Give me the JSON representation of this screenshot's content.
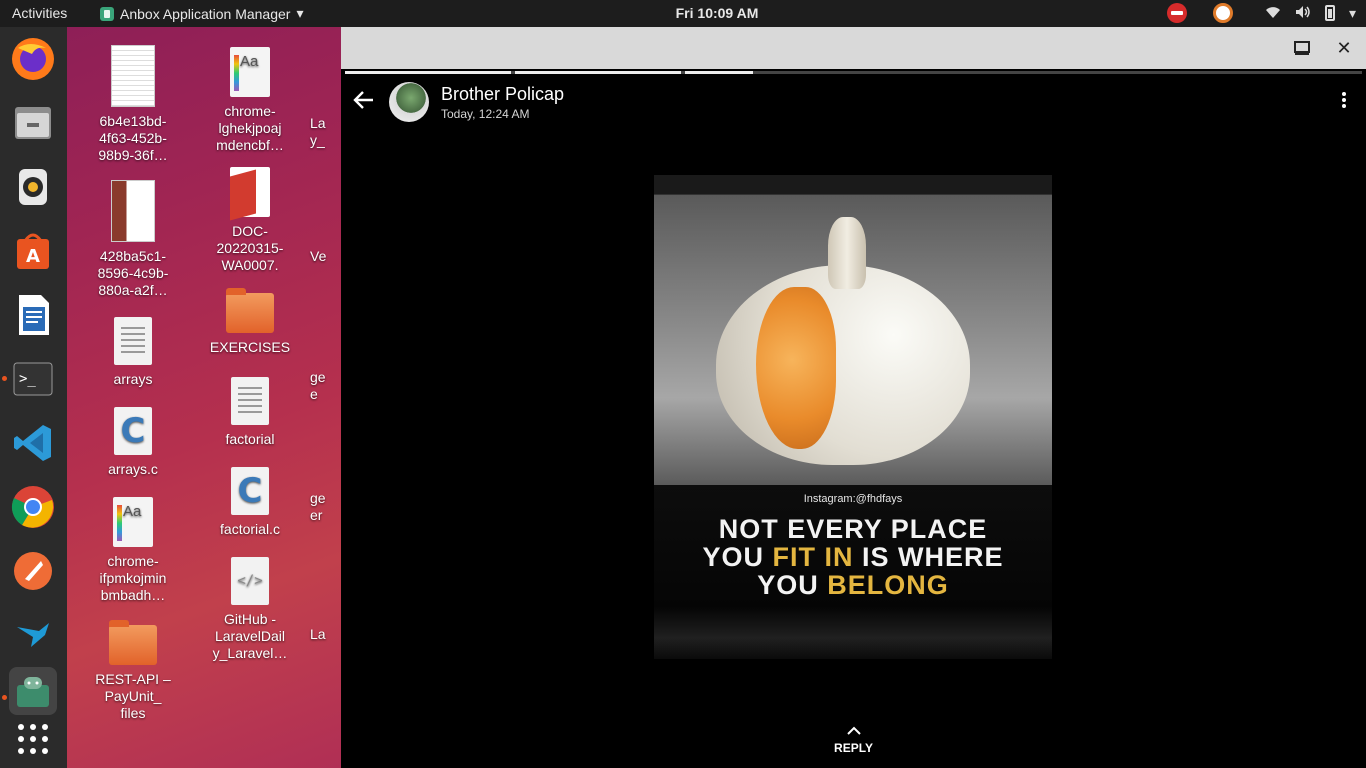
{
  "topbar": {
    "activities": "Activities",
    "app_name": "Anbox Application Manager",
    "clock": "Fri 10:09 AM"
  },
  "dock": {
    "items": [
      {
        "name": "firefox-icon"
      },
      {
        "name": "files-icon"
      },
      {
        "name": "rhythmbox-icon"
      },
      {
        "name": "software-center-icon"
      },
      {
        "name": "libreoffice-writer-icon"
      },
      {
        "name": "terminal-icon"
      },
      {
        "name": "vscode-icon"
      },
      {
        "name": "chrome-icon"
      },
      {
        "name": "postman-icon"
      },
      {
        "name": "kingfisher-icon"
      },
      {
        "name": "anbox-icon"
      },
      {
        "name": "show-applications-icon"
      }
    ]
  },
  "desktop": {
    "icons": [
      {
        "label": "6b4e13bd-\n4f63-452b-\n98b9-36f…"
      },
      {
        "label": "428ba5c1-\n8596-4c9b-\n880a-a2f…"
      },
      {
        "label": "arrays"
      },
      {
        "label": "arrays.c"
      },
      {
        "label": "chrome-\nifpmkojmin\nbmbadh…"
      },
      {
        "label": "REST-API –\nPayUnit_\nfiles"
      },
      {
        "label": "chrome-\nlghekjpoaj\nmdencbf…"
      },
      {
        "label": "DOC-\n20220315-\nWA0007."
      },
      {
        "label": "EXERCISES"
      },
      {
        "label": "factorial"
      },
      {
        "label": "factorial.c"
      },
      {
        "label": "GitHub -\nLaravelDail\ny_Laravel…"
      }
    ],
    "partial_labels": [
      "La\ny_",
      "Ve",
      "ge\ne",
      "ge\ner",
      "La"
    ]
  },
  "window": {
    "maximize_icon": "maximize-icon",
    "close_icon": "close-icon"
  },
  "status": {
    "contact_name": "Brother Policap",
    "time": "Today, 12:24 AM",
    "image_handle": "Instagram:@fhdfays",
    "quote_line1": "NOT EVERY PLACE",
    "quote_line2_a": "YOU ",
    "quote_line2_hl": "FIT IN",
    "quote_line2_b": " IS WHERE",
    "quote_line3_a": "YOU ",
    "quote_line3_hl": "BELONG",
    "reply_label": "REPLY"
  },
  "colors": {
    "ubuntu_orange": "#e95420",
    "highlight_text": "#e4b640"
  }
}
